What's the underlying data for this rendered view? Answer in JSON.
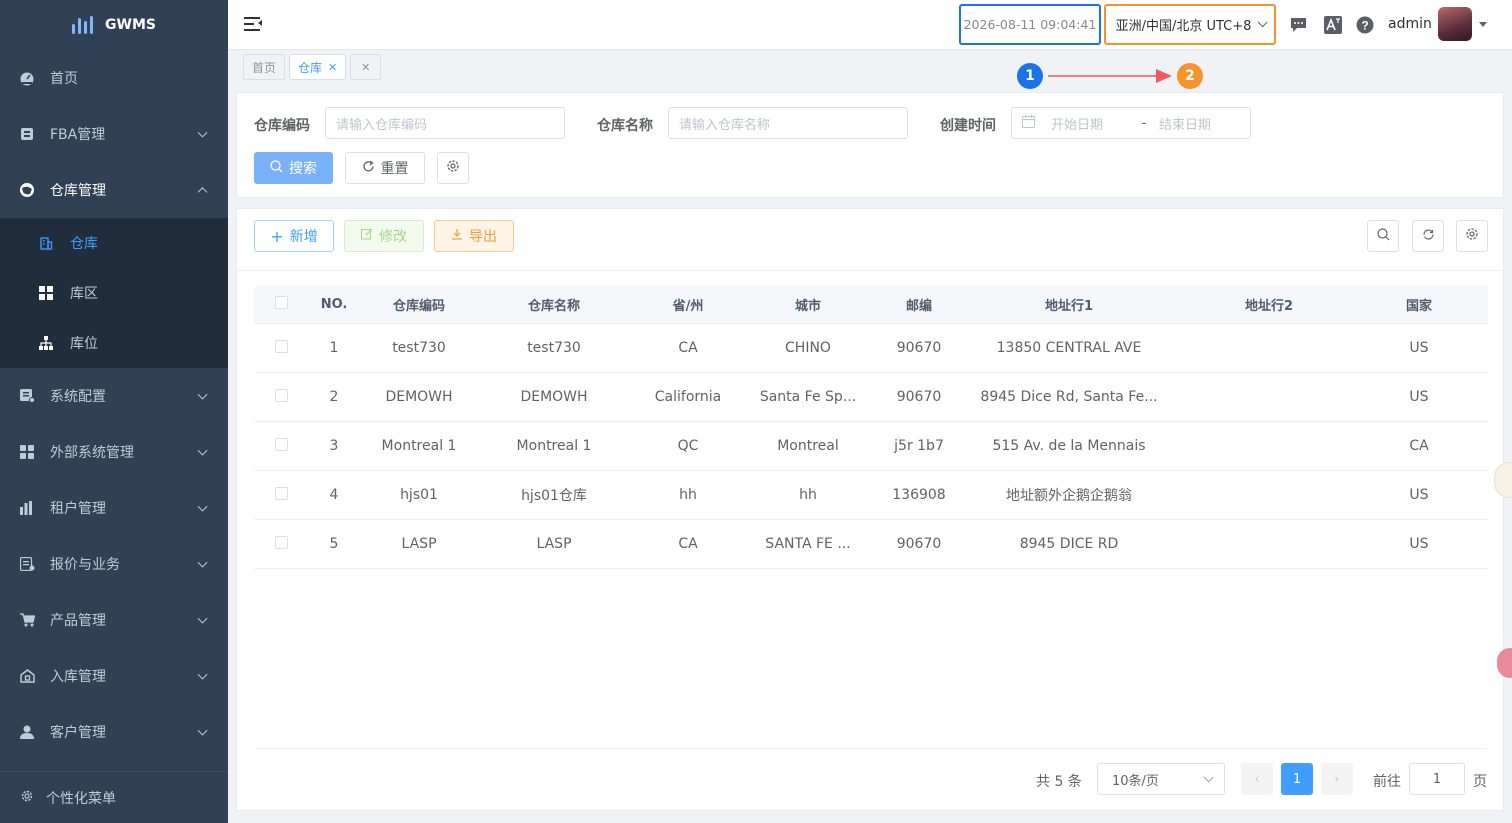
{
  "app": {
    "brand": "GWMS"
  },
  "sidebar": {
    "items": [
      {
        "label": "首页",
        "icon": "dashboard-icon"
      },
      {
        "label": "FBA管理",
        "icon": "fba-icon"
      },
      {
        "label": "仓库管理",
        "icon": "warehouse-icon"
      },
      {
        "label": "系统配置",
        "icon": "system-config-icon"
      },
      {
        "label": "外部系统管理",
        "icon": "external-system-icon"
      },
      {
        "label": "租户管理",
        "icon": "tenant-icon"
      },
      {
        "label": "报价与业务",
        "icon": "quote-icon"
      },
      {
        "label": "产品管理",
        "icon": "cart-icon"
      },
      {
        "label": "入库管理",
        "icon": "inbound-icon"
      },
      {
        "label": "客户管理",
        "icon": "user-icon"
      }
    ],
    "sub_items": [
      {
        "label": "仓库"
      },
      {
        "label": "库区"
      },
      {
        "label": "库位"
      }
    ],
    "personalize": "个性化菜单"
  },
  "navbar": {
    "datetime": "2026-08-11 09:04:41",
    "timezone": "亚洲/中国/北京 UTC+8",
    "username": "admin"
  },
  "tags": {
    "home": "首页",
    "current": "仓库"
  },
  "annotations": {
    "one": "1",
    "two": "2",
    "colors": {
      "one": "#1a73e8",
      "two": "#f5932c",
      "arrow": "#f05a5a"
    }
  },
  "search": {
    "code_label": "仓库编码",
    "code_placeholder": "请输入仓库编码",
    "name_label": "仓库名称",
    "name_placeholder": "请输入仓库名称",
    "time_label": "创建时间",
    "start_placeholder": "开始日期",
    "range_sep": "-",
    "end_placeholder": "结束日期",
    "search_btn": "搜索",
    "reset_btn": "重置"
  },
  "toolbar": {
    "add": "新增",
    "edit": "修改",
    "export": "导出"
  },
  "table": {
    "headers": [
      "NO.",
      "仓库编码",
      "仓库名称",
      "省/州",
      "城市",
      "邮编",
      "地址行1",
      "地址行2",
      "国家"
    ],
    "rows": [
      [
        "1",
        "test730",
        "test730",
        "CA",
        "CHINO",
        "90670",
        "13850 CENTRAL AVE",
        "",
        "US"
      ],
      [
        "2",
        "DEMOWH",
        "DEMOWH",
        "California",
        "Santa Fe Sp...",
        "90670",
        "8945 Dice Rd, Santa Fe...",
        "",
        "US"
      ],
      [
        "3",
        "Montreal 1",
        "Montreal 1",
        "QC",
        "Montreal",
        "j5r 1b7",
        "515 Av. de la Mennais",
        "",
        "CA"
      ],
      [
        "4",
        "hjs01",
        "hjs01仓库",
        "hh",
        "hh",
        "136908",
        "地址额外企鹅企鹅翁",
        "",
        "US"
      ],
      [
        "5",
        "LASP",
        "LASP",
        "CA",
        "SANTA FE ...",
        "90670",
        "8945 DICE RD",
        "",
        "US"
      ]
    ]
  },
  "pagination": {
    "total": "共 5 条",
    "page_size": "10条/页",
    "current_page": "1",
    "goto_label": "前往",
    "goto_value": "1",
    "page_suffix": "页"
  }
}
